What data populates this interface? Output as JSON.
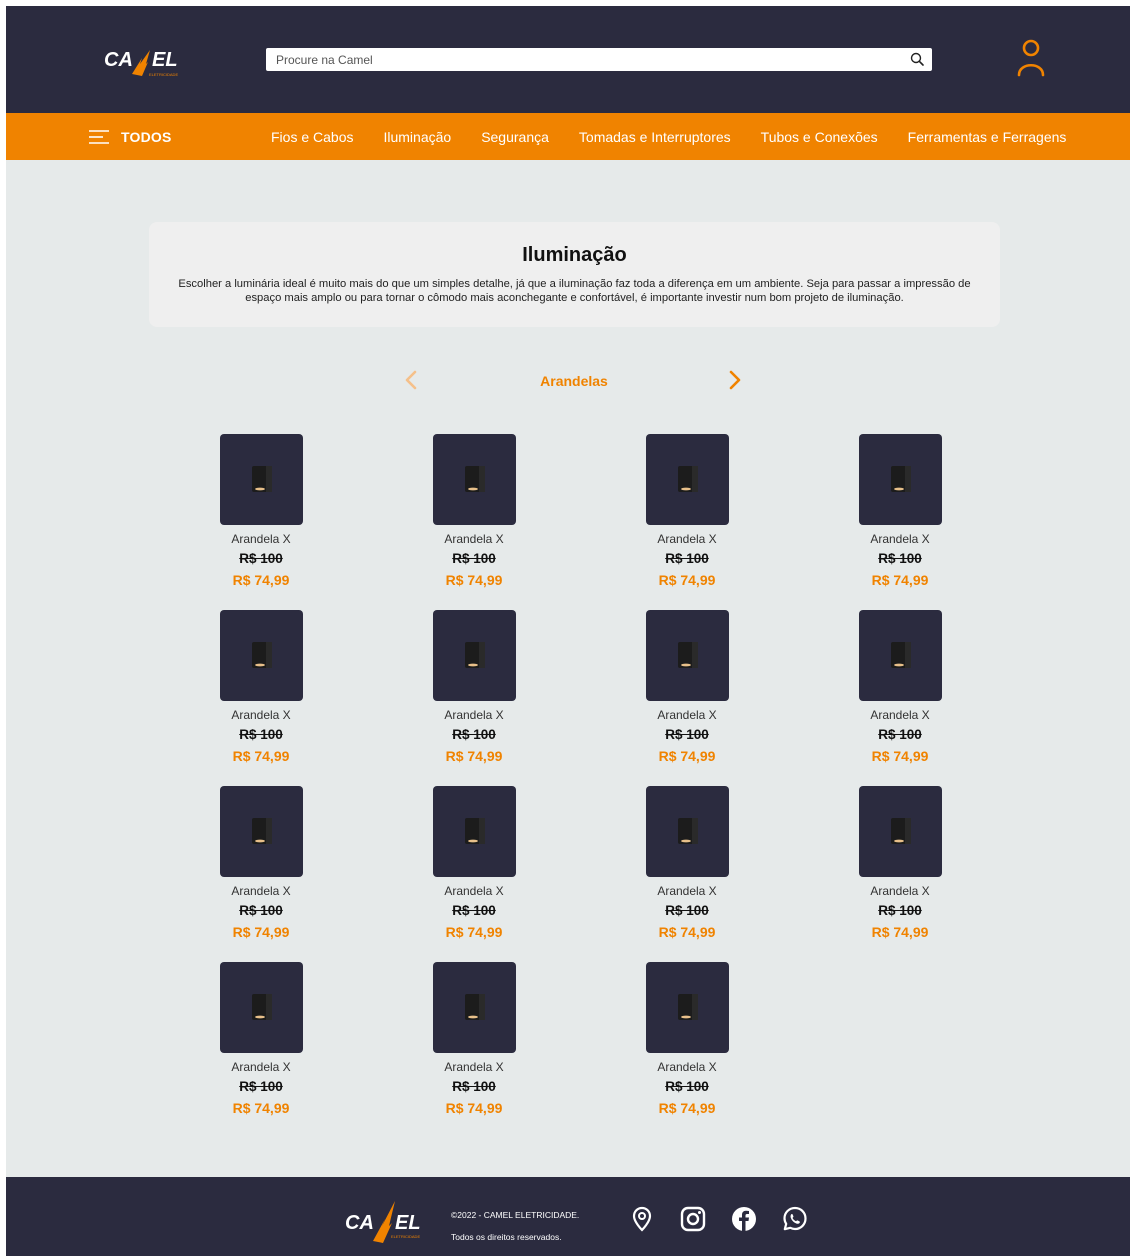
{
  "brand": {
    "logo_text": "CAMEL",
    "logo_sub": "ELETRICIDADE",
    "accent": "#f08300",
    "dark": "#2b2b3f"
  },
  "search": {
    "placeholder": "Procure na Camel"
  },
  "nav": {
    "all_label": "TODOS",
    "links": [
      "Fios e Cabos",
      "Iluminação",
      "Segurança",
      "Tomadas e Interruptores",
      "Tubos e Conexões",
      "Ferramentas e Ferragens"
    ]
  },
  "intro": {
    "title": "Iluminação",
    "text": "Escolher a luminária ideal é muito mais do que um simples detalhe, já que a iluminação faz toda a diferença em um ambiente. Seja para passar a impressão de espaço mais amplo ou para tornar o cômodo mais aconchegante e confortável, é importante investir num bom projeto de iluminação."
  },
  "category": {
    "current": "Arandelas"
  },
  "products": [
    {
      "name": "Arandela X",
      "old_price": "R$ 100",
      "price": "R$ 74,99"
    },
    {
      "name": "Arandela X",
      "old_price": "R$ 100",
      "price": "R$ 74,99"
    },
    {
      "name": "Arandela X",
      "old_price": "R$ 100",
      "price": "R$ 74,99"
    },
    {
      "name": "Arandela X",
      "old_price": "R$ 100",
      "price": "R$ 74,99"
    },
    {
      "name": "Arandela X",
      "old_price": "R$ 100",
      "price": "R$ 74,99"
    },
    {
      "name": "Arandela X",
      "old_price": "R$ 100",
      "price": "R$ 74,99"
    },
    {
      "name": "Arandela X",
      "old_price": "R$ 100",
      "price": "R$ 74,99"
    },
    {
      "name": "Arandela X",
      "old_price": "R$ 100",
      "price": "R$ 74,99"
    },
    {
      "name": "Arandela X",
      "old_price": "R$ 100",
      "price": "R$ 74,99"
    },
    {
      "name": "Arandela X",
      "old_price": "R$ 100",
      "price": "R$ 74,99"
    },
    {
      "name": "Arandela X",
      "old_price": "R$ 100",
      "price": "R$ 74,99"
    },
    {
      "name": "Arandela X",
      "old_price": "R$ 100",
      "price": "R$ 74,99"
    },
    {
      "name": "Arandela X",
      "old_price": "R$ 100",
      "price": "R$ 74,99"
    },
    {
      "name": "Arandela X",
      "old_price": "R$ 100",
      "price": "R$ 74,99"
    },
    {
      "name": "Arandela X",
      "old_price": "R$ 100",
      "price": "R$ 74,99"
    }
  ],
  "footer": {
    "copyright": "©2022 - CAMEL ELETRICIDADE.",
    "rights": "Todos os direitos reservados.",
    "social_icons": [
      "location-icon",
      "instagram-icon",
      "facebook-icon",
      "whatsapp-icon"
    ]
  }
}
